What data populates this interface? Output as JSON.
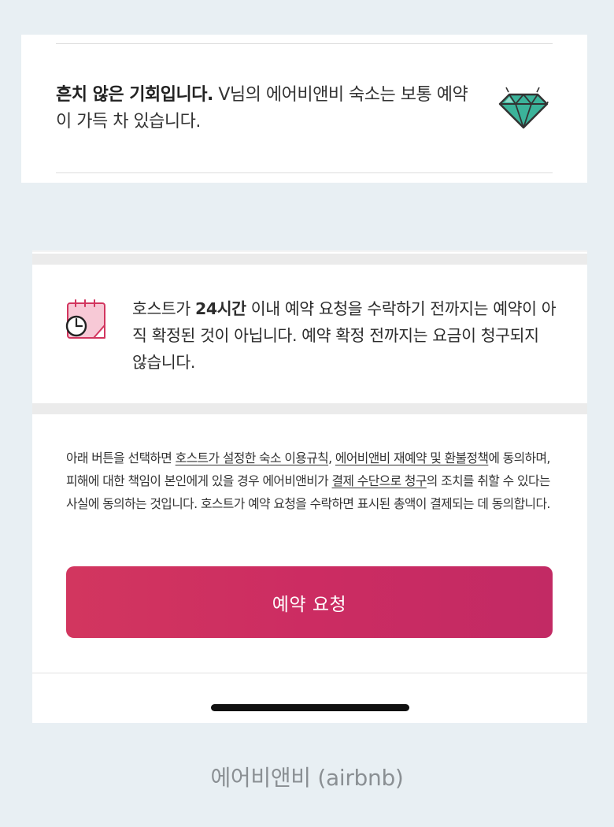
{
  "rare_card": {
    "bold_text": "흔치 않은 기회입니다.",
    "text": " V님의 에어비앤비 숙소는 보통 예약이 가득 차 있습니다.",
    "icon": "diamond-icon",
    "icon_color": "#3bb39a"
  },
  "notice": {
    "icon": "calendar-clock-icon",
    "icon_color": "#d2365f",
    "part1": "호스트가 ",
    "bold_hours": "24시간",
    "part2": " 이내 예약 요청을 수락하기 전까지는 예약이 아직 확정된 것이 아닙니다.  예약 확정 전까지는 요금이 청구되지 않습니다."
  },
  "legal": {
    "t1": "아래 버튼을 선택하면 ",
    "link1": "호스트가 설정한 숙소 이용규칙",
    "t2": ", ",
    "link2": "에어비앤비 재예약 및 환불정책",
    "t3": "에 동의하며, 피해에 대한 책임이 본인에게 있을 경우 에어비앤비가 ",
    "link3": "결제 수단으로 청구",
    "t4": "의 조치를 취할 수 있다는 사실에 동의하는 것입니다. 호스트가 예약 요청을 수락하면 표시된 총액이 결제되는 데 동의합니다."
  },
  "button": {
    "label": "예약 요청",
    "color": "#cc2c62"
  },
  "caption": "에어비앤비 (airbnb)"
}
